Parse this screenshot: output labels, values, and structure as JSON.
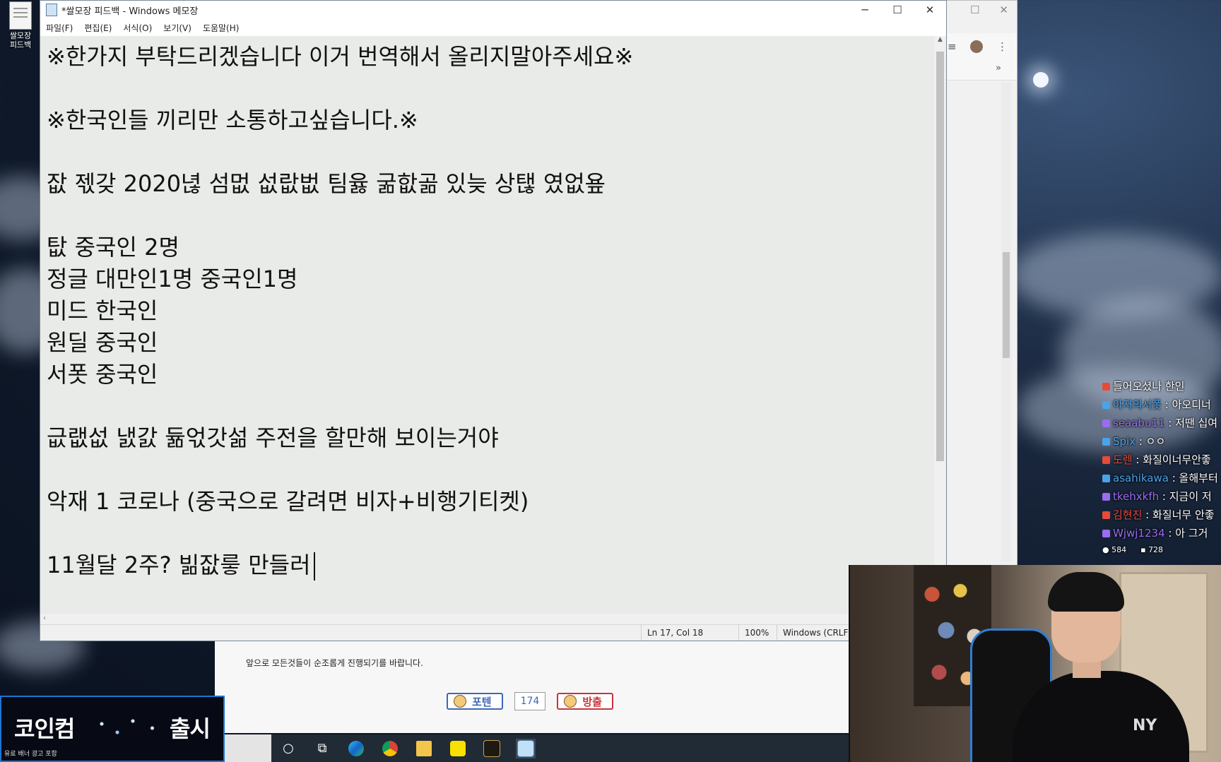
{
  "desktop": {
    "icon_label_line1": "쌀모장",
    "icon_label_line2": "피드백"
  },
  "notepad": {
    "title": "*쌀모장 피드백 - Windows 메모장",
    "menu": [
      "파일(F)",
      "편집(E)",
      "서식(O)",
      "보기(V)",
      "도움말(H)"
    ],
    "lines": [
      "※한가지 부탁드리겠습니다 이거 번역해서 올리지말아주세요※",
      "",
      "※한국인들 끼리만 소통하고싶습니다.※",
      "",
      "잢 젟갖 2020녆 섬멊 섮랎벖 팀윯 굶핪곪 있늦 상탢 였없욮",
      "",
      "탒 중국인 2명",
      "정글 대만인1명 중국인1명",
      "미드 한국인",
      "원딜 중국인",
      "서폿 중국인",
      "",
      "긊랪섮 냀갌 듊얷갓섦 주전을 할만해 보이는거야",
      "",
      "악재 1 코로나 (중국으로 갈려면 비자+비행기티켓)",
      "",
      "11월달 2주? 빎잢릏 만들러"
    ],
    "status": {
      "position": "Ln 17, Col 18",
      "zoom": "100%",
      "line_ending": "Windows (CRLF)"
    },
    "window_controls": [
      "─",
      "☐",
      "✕"
    ]
  },
  "browser_bg": {
    "controls": [
      "☐",
      "✕"
    ],
    "more_label": "»"
  },
  "chat": {
    "messages": [
      {
        "user": "",
        "text": "들어오셨나 한인"
      },
      {
        "user": "아지의서폿",
        "text": " : 아오디너"
      },
      {
        "user": "seaabu11",
        "text": " : 저땐 십여"
      },
      {
        "user": "Spix",
        "text": " : ㅇㅇ"
      },
      {
        "user": "도렌",
        "text": " : 화질이너무안좋"
      },
      {
        "user": "asahikawa",
        "text": " : 올해부터"
      },
      {
        "user": "tkehxkfh",
        "text": " : 지금이 저"
      },
      {
        "user": "김현진",
        "text": " : 화질너무 안좋"
      },
      {
        "user": "Wjwj1234",
        "text": " : 아 그거"
      }
    ],
    "viewers": "584",
    "chat_count": "728",
    "colors": [
      "#e84a3a",
      "#4aa3e8",
      "#9a6cf0",
      "#4aa3e8",
      "#e84a3a",
      "#4aa3e8",
      "#9a6cf0",
      "#e84a3a",
      "#9a6cf0"
    ]
  },
  "webpage": {
    "body_text": "앞으로 모든것들이 순조롭게 진행되기를 바랍니다.",
    "recommend_label": "포텐",
    "recommend_count": "174",
    "report_label": "방출"
  },
  "banner": {
    "left_text": "코인컴",
    "right_text": "출시",
    "footnote": "유료 배너 광고 포함"
  },
  "webcam": {
    "shirt_logo": "NY"
  },
  "taskbar": {
    "items": [
      "cortana-icon",
      "task-view-icon",
      "edge-icon",
      "chrome-icon",
      "file-explorer-icon",
      "kakaotalk-icon",
      "league-of-legends-icon",
      "notepad-icon"
    ]
  }
}
